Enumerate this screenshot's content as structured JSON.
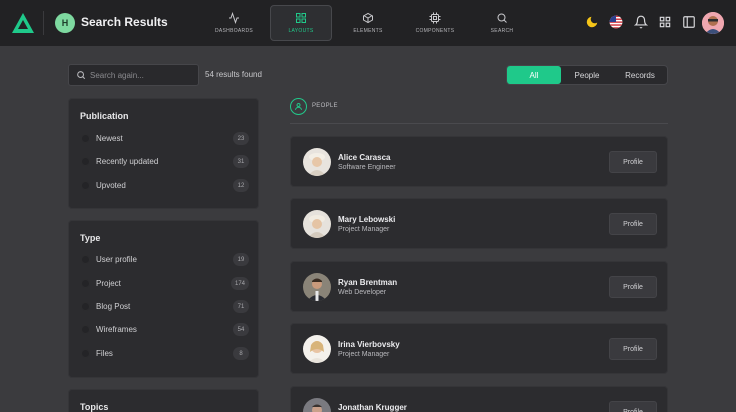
{
  "header": {
    "app_title": "Search Results",
    "avatar_initial": "H",
    "nav": [
      {
        "label": "DASHBOARDS",
        "icon": "activity-icon"
      },
      {
        "label": "LAYOUTS",
        "icon": "grid-icon",
        "active": true
      },
      {
        "label": "ELEMENTS",
        "icon": "box-icon"
      },
      {
        "label": "COMPONENTS",
        "icon": "cpu-icon"
      },
      {
        "label": "SEARCH",
        "icon": "search-icon"
      }
    ],
    "right_icons": [
      "moon-icon",
      "us-flag-icon",
      "bell-icon",
      "apps-grid-icon",
      "sidebar-panel-icon",
      "user-avatar"
    ]
  },
  "search": {
    "placeholder": "Search again...",
    "results_text": "54 results found"
  },
  "filter_tabs": [
    {
      "label": "All",
      "active": true
    },
    {
      "label": "People"
    },
    {
      "label": "Records"
    }
  ],
  "sidebar": {
    "publication": {
      "title": "Publication",
      "items": [
        {
          "label": "Newest",
          "count": "23"
        },
        {
          "label": "Recently updated",
          "count": "31"
        },
        {
          "label": "Upvoted",
          "count": "12"
        }
      ]
    },
    "type": {
      "title": "Type",
      "items": [
        {
          "label": "User profile",
          "count": "19"
        },
        {
          "label": "Project",
          "count": "174"
        },
        {
          "label": "Blog Post",
          "count": "71"
        },
        {
          "label": "Wireframes",
          "count": "54"
        },
        {
          "label": "Files",
          "count": "8"
        }
      ]
    },
    "topics": {
      "title": "Topics"
    }
  },
  "people": {
    "section_label": "PEOPLE",
    "profile_label": "Profile",
    "cards": [
      {
        "name": "Alice Carasca",
        "role": "Software Engineer"
      },
      {
        "name": "Mary Lebowski",
        "role": "Project Manager"
      },
      {
        "name": "Ryan Brentman",
        "role": "Web Developer"
      },
      {
        "name": "Irina Vierbovsky",
        "role": "Project Manager"
      },
      {
        "name": "Jonathan Krugger",
        "role": ""
      }
    ]
  },
  "colors": {
    "accent": "#1fc98a",
    "background": "#3b3b3e",
    "topbar": "#222224",
    "panel": "#2c2c2f"
  }
}
